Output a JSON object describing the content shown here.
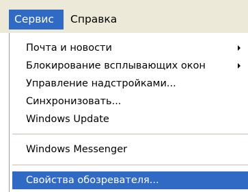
{
  "menubar": {
    "service_label": "Сервис",
    "help_label": "Справка"
  },
  "dropdown": {
    "items": [
      {
        "label": "Почта и новости",
        "has_submenu": true
      },
      {
        "label": "Блокирование всплывающих окон",
        "has_submenu": true
      },
      {
        "label": "Управление надстройками...",
        "has_submenu": false
      },
      {
        "label": "Синхронизовать...",
        "has_submenu": false
      },
      {
        "label": "Windows Update",
        "has_submenu": false
      },
      {
        "label": "Windows Messenger",
        "has_submenu": false
      },
      {
        "label": "Свойства обозревателя...",
        "has_submenu": false,
        "selected": true
      }
    ]
  },
  "colors": {
    "highlight": "#316ac5",
    "menubar_bg": "#ece9d8",
    "menu_bg": "#ffffff",
    "separator": "#c5c2b2"
  }
}
